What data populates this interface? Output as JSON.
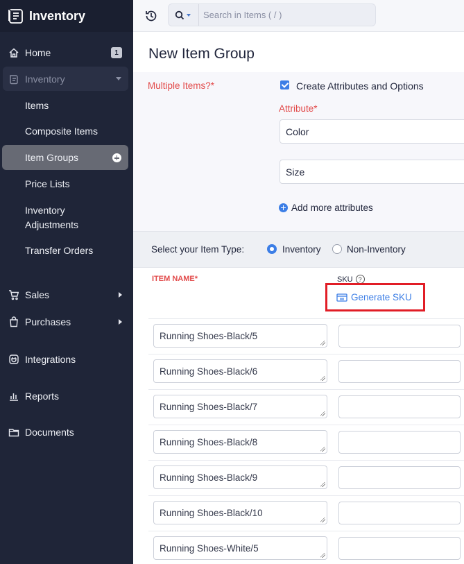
{
  "app": {
    "name": "Inventory"
  },
  "sidebar": {
    "home": {
      "label": "Home",
      "badge": "1"
    },
    "inventory": {
      "label": "Inventory"
    },
    "sub_items": [
      "Items",
      "Composite Items",
      "Item Groups",
      "Price Lists",
      "Inventory Adjustments",
      "Transfer Orders"
    ],
    "sales": {
      "label": "Sales"
    },
    "purchases": {
      "label": "Purchases"
    },
    "integrations": {
      "label": "Integrations"
    },
    "reports": {
      "label": "Reports"
    },
    "documents": {
      "label": "Documents"
    }
  },
  "search": {
    "placeholder": "Search in Items ( / )"
  },
  "page": {
    "title": "New Item Group"
  },
  "form": {
    "multiple_items_label": "Multiple Items?*",
    "create_attributes_label": "Create Attributes and Options",
    "create_attributes_checked": true,
    "attribute_label": "Attribute*",
    "attributes": [
      "Color",
      "Size"
    ],
    "add_more_label": "Add more attributes",
    "item_type_label": "Select your Item Type:",
    "item_type_options": [
      "Inventory",
      "Non-Inventory"
    ],
    "item_type_selected": "Inventory"
  },
  "table": {
    "col_item_name": "ITEM NAME*",
    "col_sku": "SKU",
    "sku_help": "?",
    "generate_sku_label": "Generate SKU",
    "rows": [
      {
        "name": "Running Shoes-Black/5",
        "sku": ""
      },
      {
        "name": "Running Shoes-Black/6",
        "sku": ""
      },
      {
        "name": "Running Shoes-Black/7",
        "sku": ""
      },
      {
        "name": "Running Shoes-Black/8",
        "sku": ""
      },
      {
        "name": "Running Shoes-Black/9",
        "sku": ""
      },
      {
        "name": "Running Shoes-Black/10",
        "sku": ""
      },
      {
        "name": "Running Shoes-White/5",
        "sku": ""
      }
    ]
  },
  "colors": {
    "sidebar_bg": "#1f2538",
    "accent": "#3c7ee6",
    "required": "#e24a4a",
    "highlight": "#e11d26"
  }
}
